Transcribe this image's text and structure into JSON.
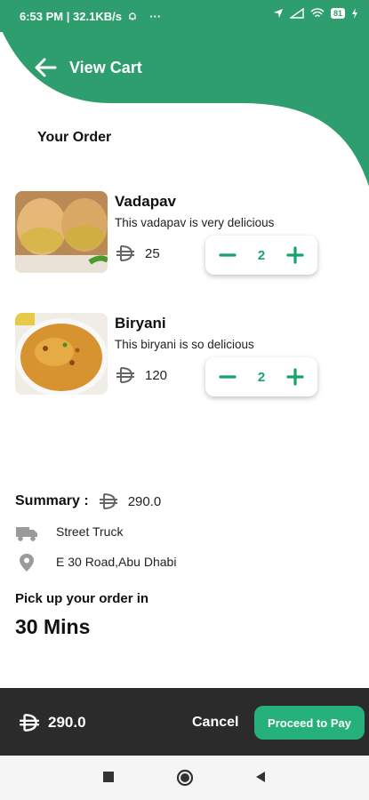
{
  "status_bar": {
    "time": "6:53 PM",
    "speed": "32.1KB/s",
    "more": "···",
    "battery": "81",
    "icons": [
      "alarm-icon",
      "location-icon",
      "signal-icon",
      "wifi-icon",
      "battery-icon",
      "charging-icon"
    ]
  },
  "header": {
    "title": "View Cart",
    "back_icon": "arrow-left-icon",
    "color": "#2e9e6f"
  },
  "section_title": "Your Order",
  "items": [
    {
      "name": "Vadapav",
      "description": "This vadapav is very delicious",
      "price": "25",
      "quantity": "2",
      "image": "vadapav-photo"
    },
    {
      "name": "Biryani",
      "description": "This biryani is so delicious",
      "price": "120",
      "quantity": "2",
      "image": "biryani-photo"
    }
  ],
  "currency_icon": "dirham-icon",
  "summary": {
    "label": "Summary :",
    "total": "290.0",
    "vendor": "Street Truck",
    "vendor_icon": "truck-icon",
    "address": "E 30 Road,Abu Dhabi",
    "address_icon": "location-pin-icon"
  },
  "pickup": {
    "label": "Pick up your order in",
    "time": "30 Mins"
  },
  "bottom_bar": {
    "total": "290.0",
    "cancel_label": "Cancel",
    "pay_label": "Proceed to Pay",
    "accent": "#25b07c"
  },
  "nav": {
    "icons": [
      "recents-square-icon",
      "home-circle-icon",
      "back-triangle-icon"
    ]
  }
}
